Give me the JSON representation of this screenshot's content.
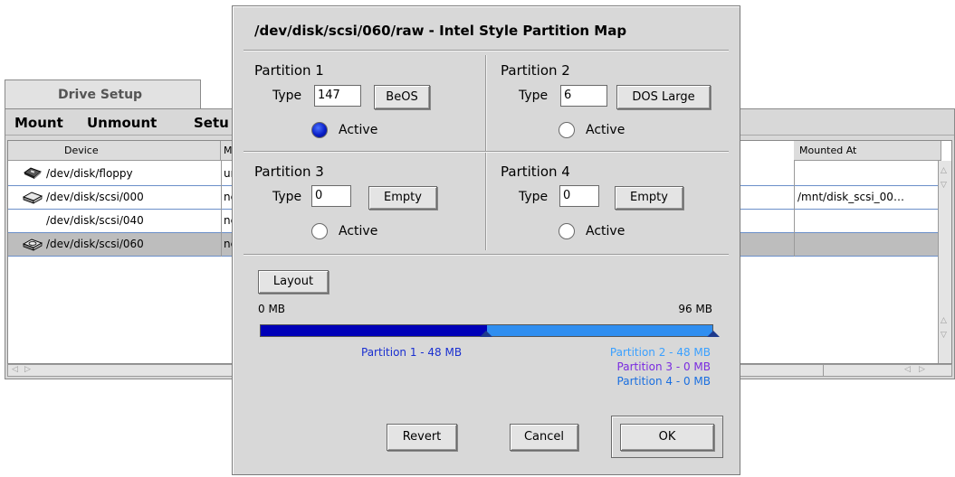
{
  "drive_setup": {
    "tab_label": "Drive Setup",
    "menu": {
      "mount": "Mount",
      "unmount": "Unmount",
      "setup": "Setu"
    },
    "columns": {
      "device": "Device",
      "media": "M",
      "mounted_at": "Mounted At"
    },
    "rows": [
      {
        "device": "/dev/disk/floppy",
        "media": "un",
        "mounted": "",
        "icon": "floppy-icon"
      },
      {
        "device": "/dev/disk/scsi/000",
        "media": "nc",
        "mounted": "/mnt/disk_scsi_00…",
        "icon": "hard-disk-icon"
      },
      {
        "device": "/dev/disk/scsi/040",
        "media": "nc",
        "mounted": "",
        "icon": ""
      },
      {
        "device": "/dev/disk/scsi/060",
        "media": "nc",
        "mounted": "",
        "icon": "removable-disk-icon",
        "selected": true
      }
    ]
  },
  "dialog": {
    "title": "/dev/disk/scsi/060/raw - Intel Style Partition Map",
    "type_label": "Type",
    "active_label": "Active",
    "partitions": [
      {
        "label": "Partition 1",
        "type_value": "147",
        "type_button": "BeOS",
        "active": true
      },
      {
        "label": "Partition 2",
        "type_value": "6",
        "type_button": "DOS Large",
        "active": false
      },
      {
        "label": "Partition 3",
        "type_value": "0",
        "type_button": "Empty",
        "active": false
      },
      {
        "label": "Partition 4",
        "type_value": "0",
        "type_button": "Empty",
        "active": false
      }
    ],
    "layout_button": "Layout",
    "bar": {
      "min_label": "0 MB",
      "max_label": "96 MB",
      "partition1_fraction": 0.5,
      "colors": {
        "p1": "#0000b8",
        "p2": "#2f8ef0"
      }
    },
    "legend": {
      "p1": "Partition 1 - 48 MB",
      "p2": "Partition 2 - 48 MB",
      "p3": "Partition 3 - 0 MB",
      "p4": "Partition 4 - 0 MB",
      "colors": {
        "p1": "#1a2fd0",
        "p2": "#3aa0ff",
        "p3": "#7a2be0",
        "p4": "#1a6fe0"
      }
    },
    "buttons": {
      "revert": "Revert",
      "cancel": "Cancel",
      "ok": "OK"
    }
  }
}
